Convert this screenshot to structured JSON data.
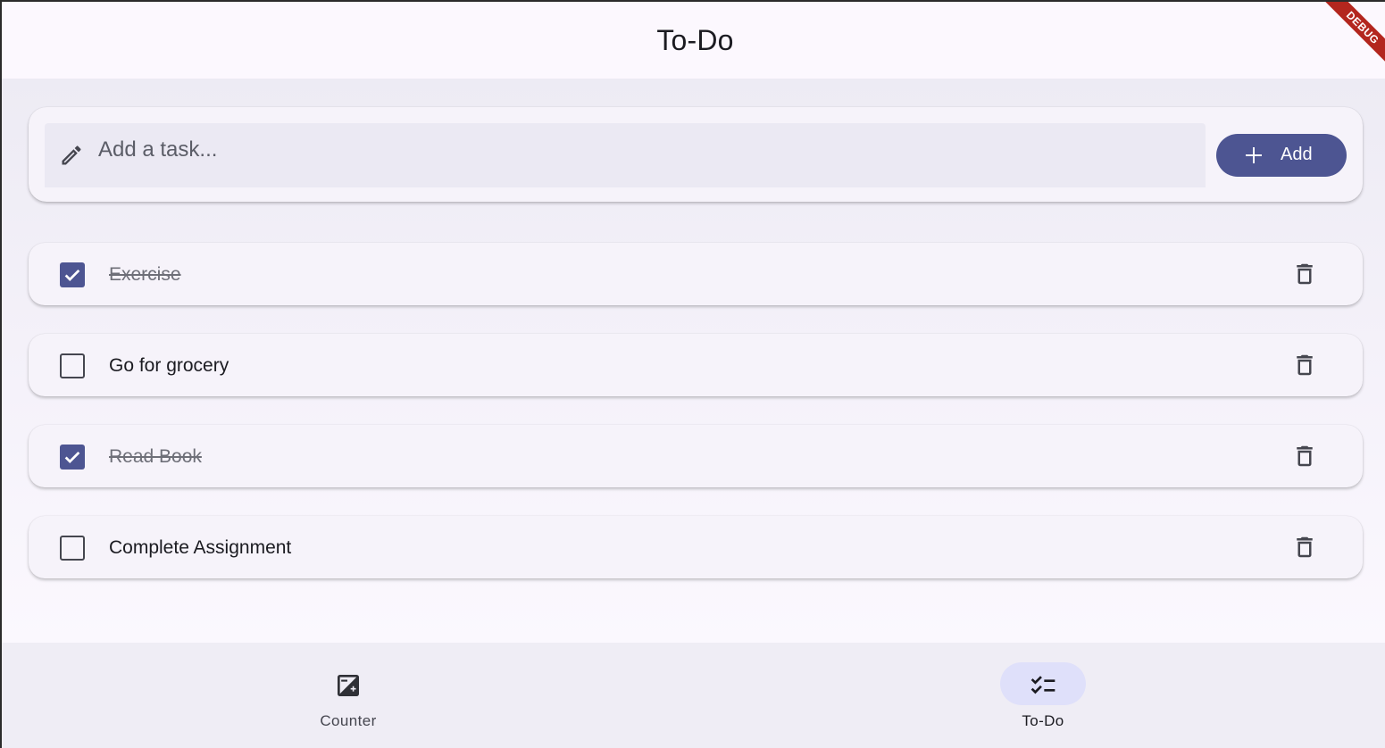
{
  "appbar": {
    "title": "To-Do",
    "debug_banner": "DEBUG"
  },
  "input": {
    "placeholder": "Add a task...",
    "value": "",
    "icon": "pencil-icon",
    "add_button_label": "Add",
    "add_button_icon": "plus-icon"
  },
  "tasks": [
    {
      "label": "Exercise",
      "done": true
    },
    {
      "label": "Go for grocery",
      "done": false
    },
    {
      "label": "Read Book",
      "done": true
    },
    {
      "label": "Complete Assignment",
      "done": false
    }
  ],
  "nav": {
    "items": [
      {
        "label": "Counter",
        "icon": "exposure-plus-icon",
        "active": false
      },
      {
        "label": "To-Do",
        "icon": "checklist-icon",
        "active": true
      }
    ]
  },
  "colors": {
    "primary": "#4d5592",
    "nav_indicator": "#dfe0fa",
    "debug_ribbon": "#b3261e"
  }
}
